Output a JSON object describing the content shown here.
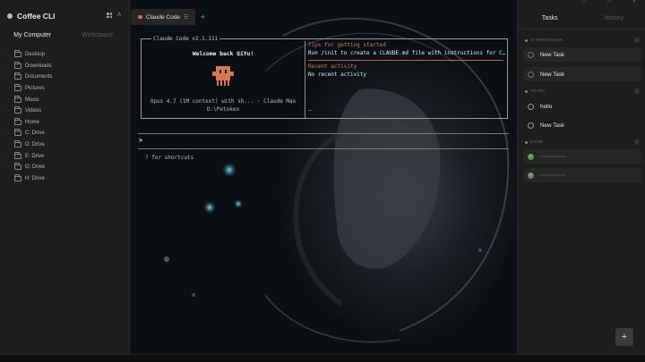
{
  "app": {
    "title": "Coffee CLI"
  },
  "sidebar": {
    "tabs": [
      {
        "label": "My Computer"
      },
      {
        "label": "Workspace"
      }
    ],
    "items": [
      {
        "label": "Desktop"
      },
      {
        "label": "Downloads"
      },
      {
        "label": "Documents"
      },
      {
        "label": "Pictures"
      },
      {
        "label": "Music"
      },
      {
        "label": "Videos"
      },
      {
        "label": "Home"
      },
      {
        "label": "C: Drive"
      },
      {
        "label": "D: Drive"
      },
      {
        "label": "E: Drive"
      },
      {
        "label": "G: Drive"
      },
      {
        "label": "H: Drive"
      }
    ]
  },
  "center": {
    "tab": {
      "label": "Claude Code"
    },
    "terminal": {
      "box_title": "Claude Code v2.1.111",
      "welcome": "Welcome back QiYu!",
      "model_line": "Opus 4.7 (1M context) with sh... · Claude Max",
      "user_line": "D:\\Petoken",
      "tips_heading": "Tips for getting started",
      "tips_text": "Run /init to create a CLAUDE.md file with instructions for C…",
      "recent_heading": "Recent activity",
      "recent_text": "No recent activity",
      "cursor_mark": "—",
      "prompt_glyph": ">",
      "shortcuts": "? for shortcuts"
    }
  },
  "tasks_panel": {
    "tabs": [
      {
        "label": "Tasks"
      },
      {
        "label": "History"
      }
    ],
    "sections": {
      "in_progress": {
        "label": "IN PROGRESS",
        "count": "2"
      },
      "todo": {
        "label": "TO-DO",
        "count": "2"
      },
      "done": {
        "label": "DONE",
        "count": "2"
      }
    },
    "in_progress": [
      {
        "label": "New Task"
      },
      {
        "label": "New Task"
      }
    ],
    "todo": [
      {
        "label": "hello"
      },
      {
        "label": "New Task"
      }
    ],
    "add_label": "+"
  },
  "colors": {
    "accent_orange": "#d07e5e",
    "panel_bg": "#1d1d1d",
    "done_check": "#5e8f5a"
  }
}
